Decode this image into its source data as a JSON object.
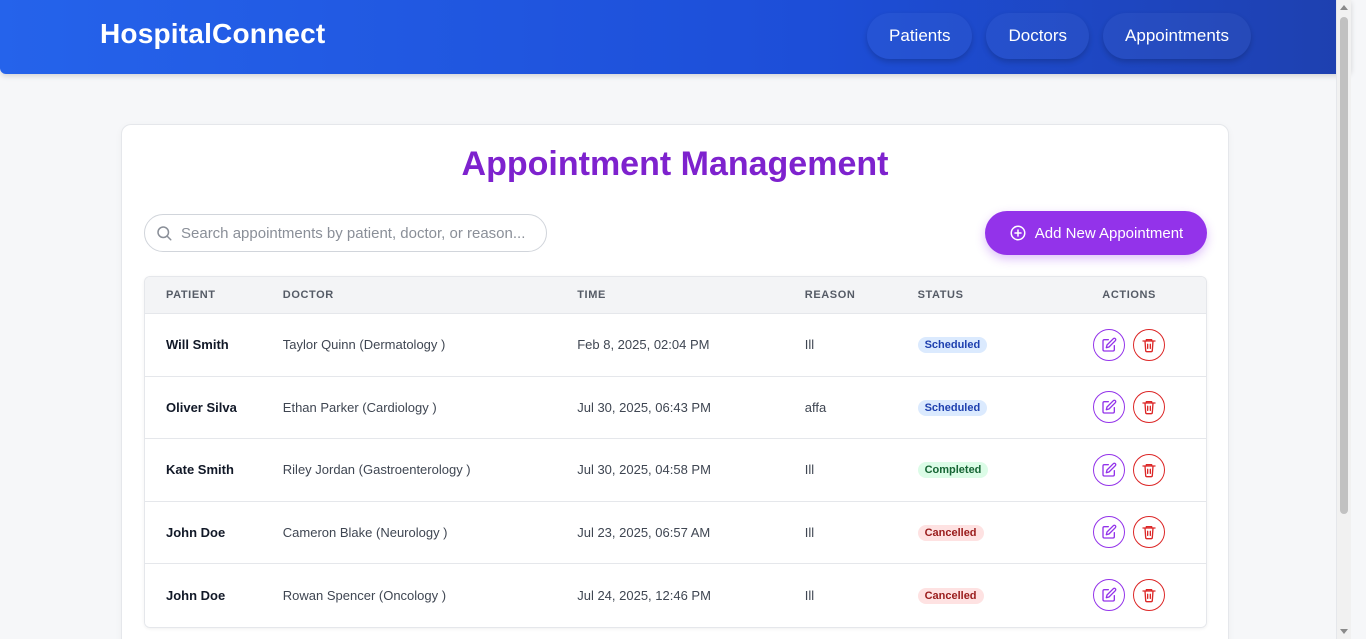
{
  "app": {
    "brand": "HospitalConnect"
  },
  "nav": [
    {
      "label": "Patients"
    },
    {
      "label": "Doctors"
    },
    {
      "label": "Appointments"
    }
  ],
  "main": {
    "title": "Appointment Management",
    "search": {
      "placeholder": "Search appointments by patient, doctor, or reason...",
      "value": ""
    },
    "add_button": "Add New Appointment",
    "columns": {
      "patient": "PATIENT",
      "doctor": "DOCTOR",
      "time": "TIME",
      "reason": "REASON",
      "status": "STATUS",
      "actions": "ACTIONS"
    },
    "rows": [
      {
        "patient": "Will Smith",
        "doctor": "Taylor Quinn (Dermatology )",
        "time": "Feb 8, 2025, 02:04 PM",
        "reason": "Ill",
        "status": "Scheduled"
      },
      {
        "patient": "Oliver Silva",
        "doctor": "Ethan Parker (Cardiology )",
        "time": "Jul 30, 2025, 06:43 PM",
        "reason": "affa",
        "status": "Scheduled"
      },
      {
        "patient": "Kate Smith",
        "doctor": "Riley Jordan (Gastroenterology )",
        "time": "Jul 30, 2025, 04:58 PM",
        "reason": "Ill",
        "status": "Completed"
      },
      {
        "patient": "John Doe",
        "doctor": "Cameron Blake (Neurology )",
        "time": "Jul 23, 2025, 06:57 AM",
        "reason": "Ill",
        "status": "Cancelled"
      },
      {
        "patient": "John Doe",
        "doctor": "Rowan Spencer (Oncology )",
        "time": "Jul 24, 2025, 12:46 PM",
        "reason": "Ill",
        "status": "Cancelled"
      }
    ]
  },
  "colors": {
    "nav_gradient_start": "#2563eb",
    "nav_gradient_end": "#1e40af",
    "title": "#7e22ce",
    "accent": "#9333ea",
    "delete": "#dc2626"
  },
  "icons": {
    "search": "search-icon",
    "add": "plus-circle-icon",
    "edit": "edit-icon",
    "delete": "trash-icon"
  }
}
